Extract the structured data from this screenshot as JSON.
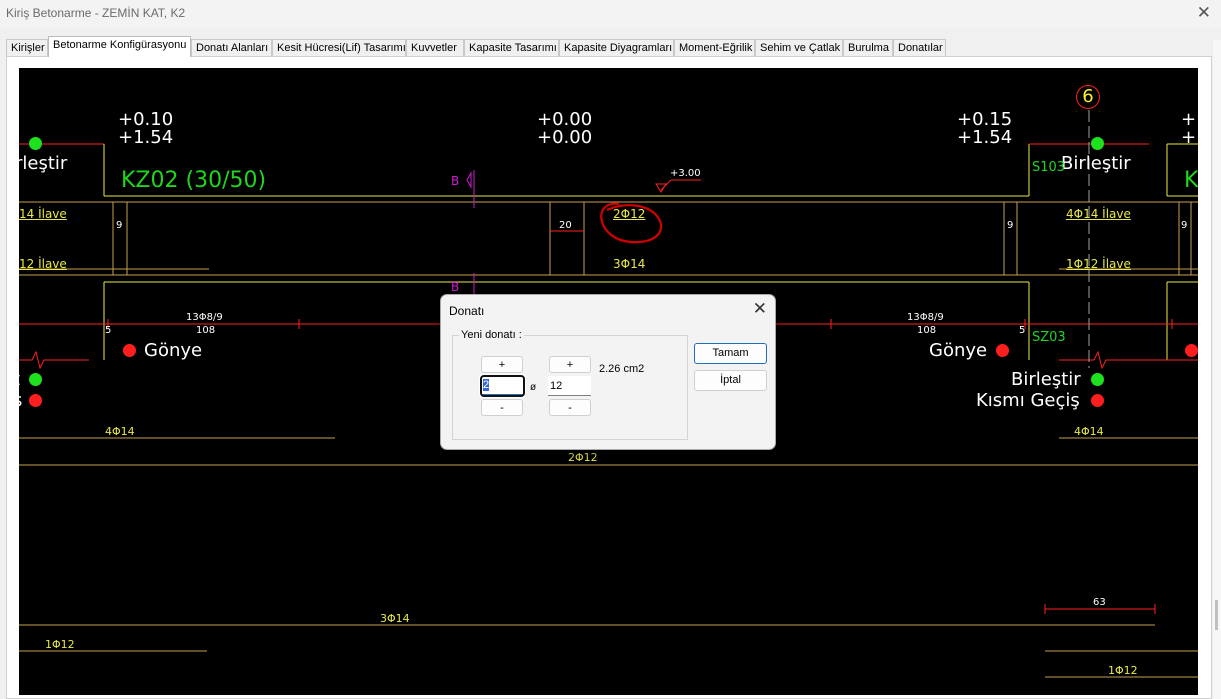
{
  "window": {
    "title": "Kiriş Betonarme - ZEMİN KAT, K2"
  },
  "tabs": [
    "Kirişler",
    "Betonarme Konfigürasyonu",
    "Donatı Alanları",
    "Kesit Hücresi(Lif) Tasarımı",
    "Kuvvetler",
    "Kapasite Tasarımı",
    "Kapasite Diyagramları",
    "Moment-Eğrilik",
    "Sehim ve Çatlak",
    "Burulma",
    "Donatılar"
  ],
  "active_tab": "Betonarme Konfigürasyonu",
  "drawing": {
    "axis_number": "6",
    "left_elev": [
      "+0.10",
      "+1.54"
    ],
    "mid_elev": [
      "+0.00",
      "+0.00"
    ],
    "right_elev": [
      "+0.15",
      "+1.54"
    ],
    "right_edge_elev": [
      "+",
      "+"
    ],
    "left_birlestir_top": "rleştir",
    "right_birlestir_top": "Birleştir",
    "beam_label": "KZ02 (30/50)",
    "right_edge_green": "K",
    "section_mark_b": "B",
    "section_mark_b2": "B",
    "level_mark": "+3.00",
    "column_top": "S103",
    "column_bottom": "SZ03",
    "top_bar_left": "14 İlave",
    "top_bar_right": "4Φ14 İlave",
    "mid_top_bar": "2Φ12",
    "dim_9a": "9",
    "dim_20": "20",
    "dim_9b": "9",
    "dim_9c": "9",
    "bot_bar_left": "12 İlave",
    "bot_bar_right": "1Φ12 İlave",
    "mid_bot_bar": "3Φ14",
    "stirrup_left": "13Φ8/9",
    "stirrup_right": "13Φ8/9",
    "span_left": "108",
    "span_right": "108",
    "dim_5a": "5",
    "dim_5b": "5",
    "gonye_left": "Gönye",
    "gonye_right": "Gönye",
    "birlestir_right": "Birleştir",
    "kismi_gecis": "Kısmı Geçiş",
    "left_cut_t": "t",
    "left_cut_s": "s",
    "bar_4phi14_left": "4Φ14",
    "bar_4phi14_right": "4Φ14",
    "bar_2phi12": "2Φ12",
    "dim_63": "63",
    "bar_3phi14": "3Φ14",
    "bar_1phi12_left": "1Φ12",
    "bar_1phi12_right": "1Φ12"
  },
  "dialog": {
    "title": "Donatı",
    "group_label": "Yeni donatı :",
    "count_plus": "+",
    "count_value": "2",
    "count_minus": "-",
    "diameter_symbol": "ø",
    "dia_plus": "+",
    "dia_value": "12",
    "dia_minus": "-",
    "area": "2.26 cm2",
    "ok": "Tamam",
    "cancel": "İptal"
  },
  "colors": {
    "canvas": "#000000",
    "green_text": "#1ed61e",
    "rebar_yellow": "#e8e84a",
    "red_lines": "#ff2020",
    "annotation_circle": "#d40000",
    "accent_blue": "#1f6fbf"
  }
}
